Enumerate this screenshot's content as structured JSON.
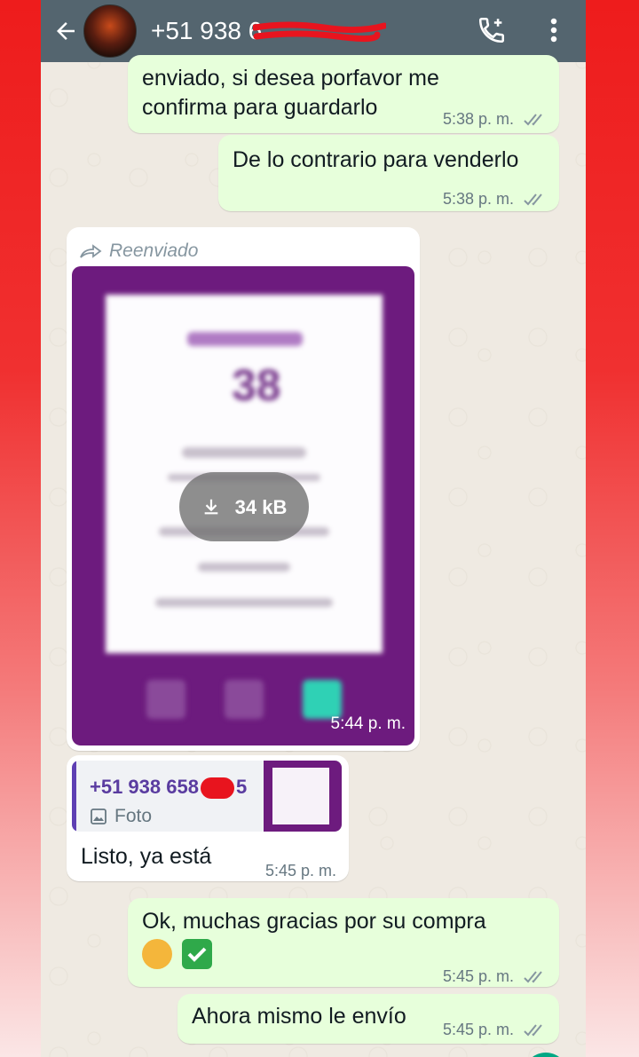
{
  "header": {
    "contact_name": "+51 938 6",
    "back_label": "←"
  },
  "messages": [
    {
      "text": "enviado, si desea porfavor me confirma para guardarlo",
      "line1": "enviado, si desea porfavor me",
      "line2": "confirma para guardarlo",
      "time": "5:38 p. m."
    },
    {
      "text": "De lo contrario para venderlo",
      "time": "5:38 p. m."
    },
    {
      "forwarded_label": "Reenviado",
      "image_amount": "38",
      "download_size": "34 kB",
      "time": "5:44 p. m."
    },
    {
      "quote_name": "+51 938 658",
      "quote_suffix": "5",
      "quote_type": "Foto",
      "text": "Listo, ya está",
      "time": "5:45 p. m."
    },
    {
      "text": "Ok, muchas gracias por su compra",
      "time": "5:45 p. m."
    },
    {
      "text": "Ahora mismo le envío",
      "time": "5:45 p. m."
    }
  ],
  "colors": {
    "header": "#54656f",
    "outgoing": "#e7ffdb",
    "incoming": "#ffffff",
    "read_ticks": "#8696a0",
    "image_bg": "#6d1b7e"
  }
}
